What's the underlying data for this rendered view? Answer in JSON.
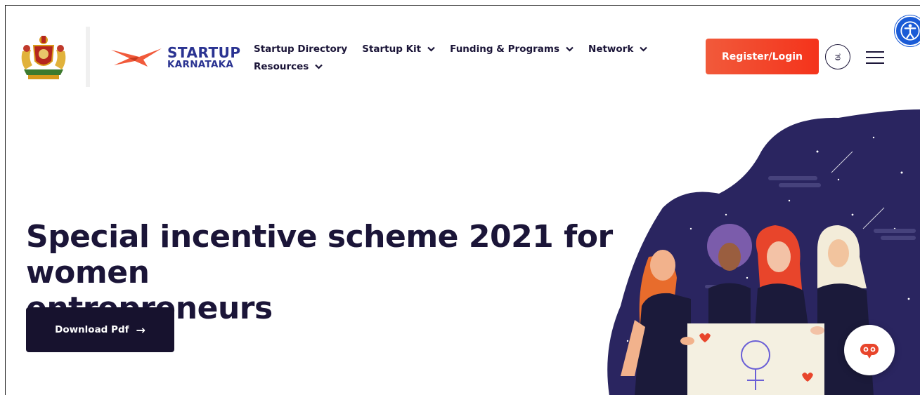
{
  "header": {
    "logo": {
      "top": "STARTUP",
      "bottom": "KARNATAKA"
    },
    "nav": [
      {
        "label": "Startup Directory",
        "dropdown": false
      },
      {
        "label": "Startup Kit",
        "dropdown": true
      },
      {
        "label": "Funding & Programs",
        "dropdown": true
      },
      {
        "label": "Network",
        "dropdown": true
      },
      {
        "label": "Resources",
        "dropdown": true
      }
    ],
    "register_label": "Register/Login",
    "language_glyph": "ತ"
  },
  "hero": {
    "title_line1": "Special incentive scheme 2021 for women",
    "title_line2": "entrepreneurs",
    "download_label": "Download Pdf",
    "download_arrow": "→"
  },
  "colors": {
    "brand_navy": "#1b1538",
    "brand_orange": "#f15a3b",
    "logo_blue": "#2a3391",
    "hero_bg": "#2a2560",
    "accessibility_blue": "#1a5bd6"
  },
  "icons": {
    "emblem": "karnataka-emblem-icon",
    "logo_mark": "startup-karnataka-bird-icon",
    "language": "kannada-language-icon",
    "menu": "hamburger-menu-icon",
    "accessibility": "accessibility-icon",
    "chatbot": "chatbot-icon",
    "arrow": "arrow-right-icon"
  }
}
